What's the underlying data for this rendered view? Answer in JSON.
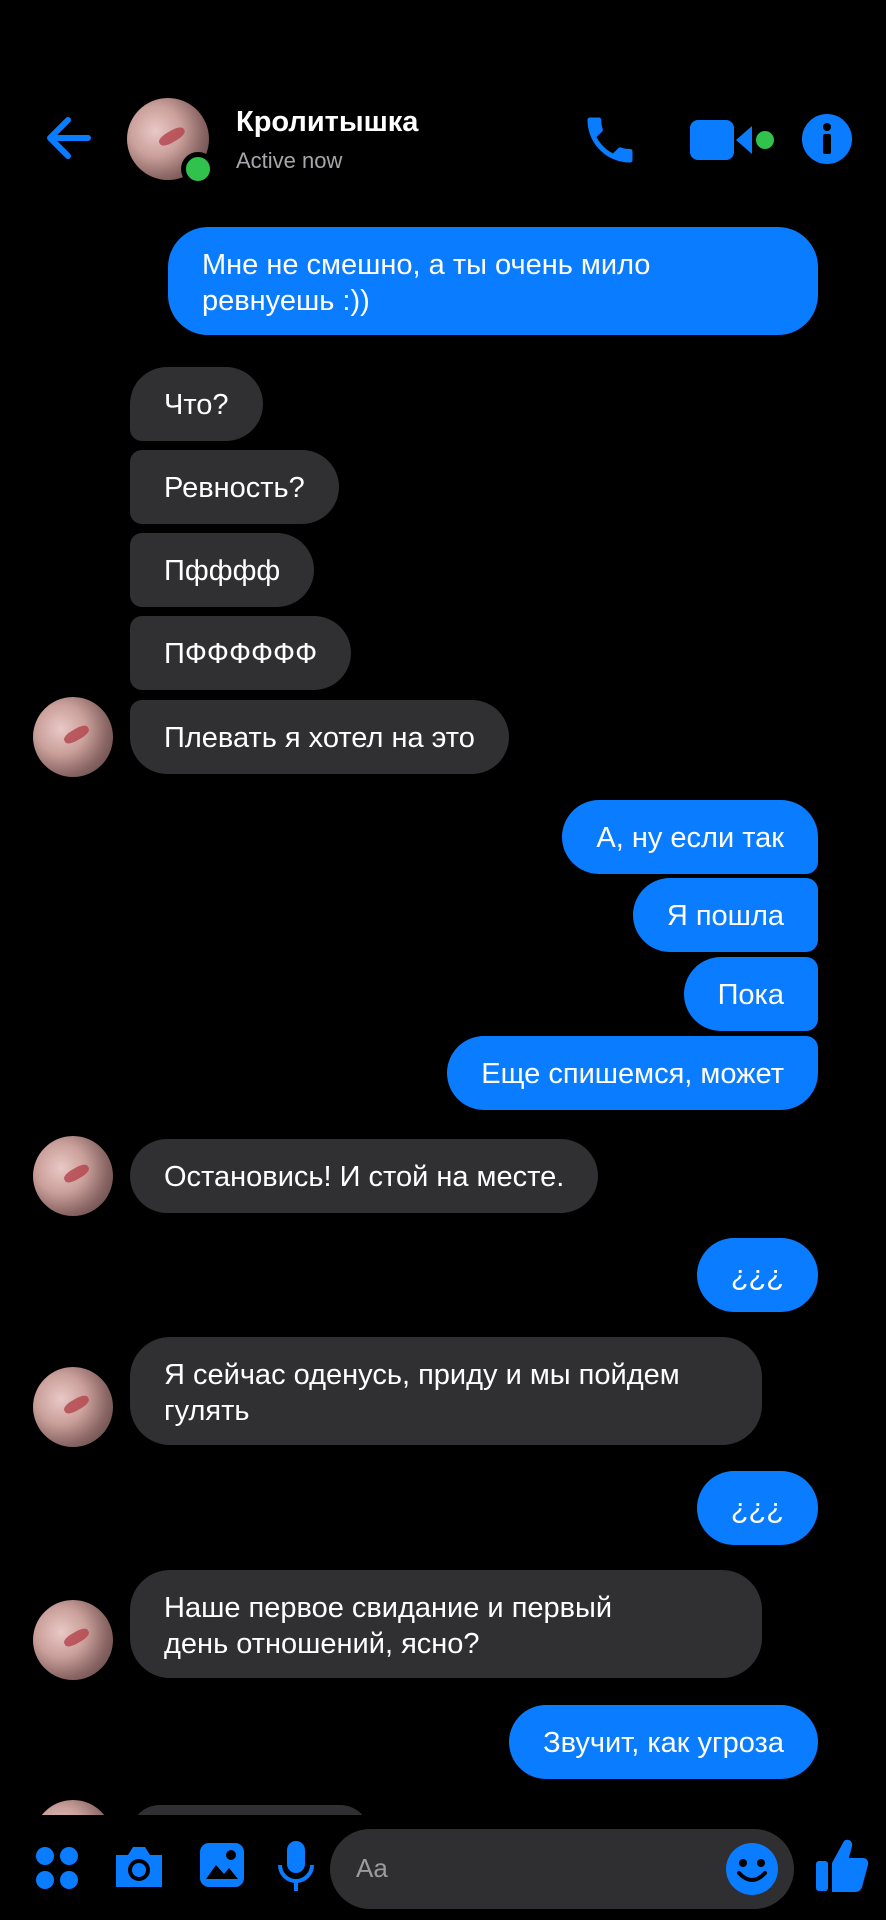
{
  "header": {
    "contact_name": "Кролитышка",
    "status": "Active now",
    "icons": [
      "back-arrow-icon",
      "phone-icon",
      "video-camera-icon",
      "info-icon"
    ],
    "accent": "#0a7cff",
    "online_color": "#31c24d"
  },
  "messages": [
    {
      "dir": "out",
      "text": "Мне не смешно, а ты очень мило\nревнуешь :))"
    },
    {
      "dir": "in",
      "text": "Что?"
    },
    {
      "dir": "in",
      "text": "Ревность?"
    },
    {
      "dir": "in",
      "text": "Пфффф"
    },
    {
      "dir": "in",
      "text": "ПФФФФФФ"
    },
    {
      "dir": "in",
      "text": "Плевать я хотел на это"
    },
    {
      "dir": "out",
      "text": "А, ну если так"
    },
    {
      "dir": "out",
      "text": "Я пошла"
    },
    {
      "dir": "out",
      "text": "Пока"
    },
    {
      "dir": "out",
      "text": "Еще спишемся, может"
    },
    {
      "dir": "in",
      "text": "Остановись! И стой на месте."
    },
    {
      "dir": "out",
      "text": "¿¿¿"
    },
    {
      "dir": "in",
      "text": "Я сейчас оденусь, приду и мы пойдем\nгулять"
    },
    {
      "dir": "out",
      "text": "¿¿¿"
    },
    {
      "dir": "in",
      "text": "Наше первое свидание и первый\nдень отношений, ясно?"
    },
    {
      "dir": "out",
      "text": "Звучит, как угроза"
    }
  ],
  "composer": {
    "placeholder": "Aa",
    "icons": [
      "apps-icon",
      "camera-icon",
      "gallery-icon",
      "microphone-icon",
      "emoji-icon",
      "thumbs-up-icon"
    ]
  }
}
